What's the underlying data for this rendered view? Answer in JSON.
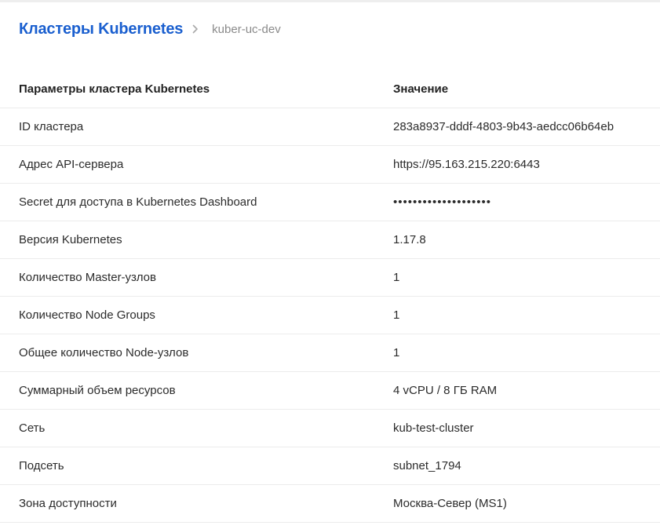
{
  "breadcrumb": {
    "root": "Кластеры Kubernetes",
    "separator_icon": "chevron-right-icon",
    "current": "kuber-uc-dev"
  },
  "table": {
    "headers": {
      "name": "Параметры кластера Kubernetes",
      "value": "Значение"
    },
    "rows": [
      {
        "name": "ID кластера",
        "value": "283a8937-dddf-4803-9b43-aedcc06b64eb"
      },
      {
        "name": "Адрес API-сервера",
        "value": "https://95.163.215.220:6443"
      },
      {
        "name": "Secret для доступа в Kubernetes Dashboard",
        "value": "••••••••••••••••••••"
      },
      {
        "name": "Версия Kubernetes",
        "value": "1.17.8"
      },
      {
        "name": "Количество Master-узлов",
        "value": "1"
      },
      {
        "name": "Количество Node Groups",
        "value": "1"
      },
      {
        "name": "Общее количество Node-узлов",
        "value": "1"
      },
      {
        "name": "Суммарный объем ресурсов",
        "value": "4 vCPU / 8 ГБ RAM"
      },
      {
        "name": "Сеть",
        "value": "kub-test-cluster"
      },
      {
        "name": "Подсеть",
        "value": "subnet_1794"
      },
      {
        "name": "Зона доступности",
        "value": "Москва-Север (MS1)"
      }
    ]
  },
  "colors": {
    "link": "#1a5fcf",
    "muted": "#8a8a8a",
    "divider": "#ececec"
  }
}
